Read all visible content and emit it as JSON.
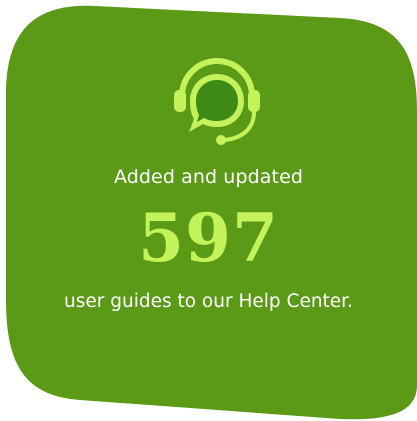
{
  "card": {
    "line1": "Added and updated",
    "number": "597",
    "line2": "user guides to our Help Center."
  },
  "colors": {
    "card_bg": "#5b9a17",
    "accent": "#c4f25a",
    "icon_dark": "#3e8a16",
    "text": "#ffffff"
  },
  "icons": {
    "main": "headset-chat-icon"
  }
}
